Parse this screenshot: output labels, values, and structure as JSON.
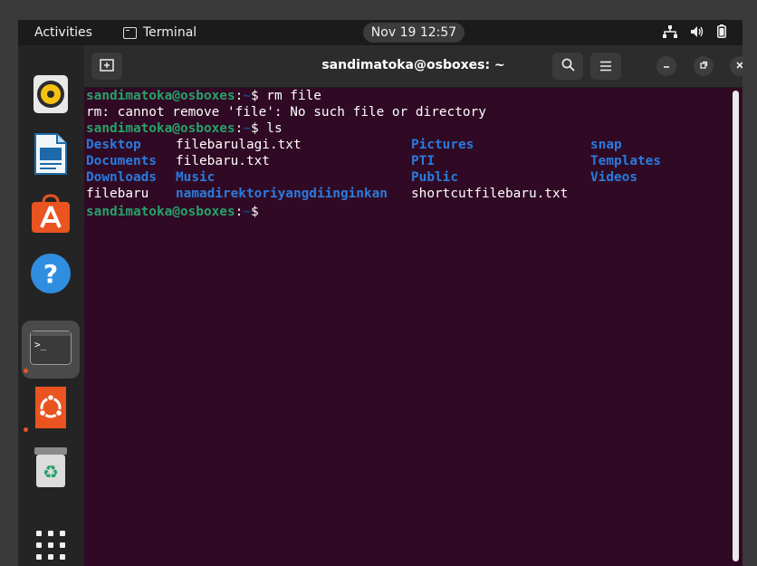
{
  "topbar": {
    "activities": "Activities",
    "app_name": "Terminal",
    "clock": "Nov 19  12:57",
    "icons": [
      "network-icon",
      "volume-icon",
      "battery-icon"
    ]
  },
  "dock": {
    "items": [
      "rhythmbox-icon",
      "libreoffice-writer-icon",
      "ubuntu-software-icon",
      "help-icon",
      "terminal-icon",
      "ubuntu-icon",
      "trash-icon",
      "show-apps-icon"
    ],
    "accent": "#e95420"
  },
  "window": {
    "title": "sandimatoka@osboxes: ~",
    "buttons": [
      "new-tab-icon",
      "search-icon",
      "menu-icon",
      "minimize-icon",
      "maximize-icon",
      "close-icon"
    ]
  },
  "terminal": {
    "prompt_user": "sandimatoka@osboxes",
    "prompt_sep": ":",
    "prompt_path": "~",
    "prompt_end": "$ ",
    "cmd1": "rm file",
    "error": "rm: cannot remove 'file': No such file or directory",
    "cmd2": "ls",
    "ls_rows": [
      [
        "Desktop",
        "filebarulagi.txt",
        "Pictures",
        "snap"
      ],
      [
        "Documents",
        "filebaru.txt",
        "PTI",
        "Templates"
      ],
      [
        "Downloads",
        "Music",
        "Public",
        "Videos"
      ],
      [
        "filebaru",
        "namadirektoriyangdiinginkan",
        "shortcutfilebaru.txt",
        ""
      ]
    ],
    "colors": {
      "background": "#300a24",
      "user": "#26a269",
      "path": "#12488b",
      "dir": "#2a7bde"
    }
  }
}
